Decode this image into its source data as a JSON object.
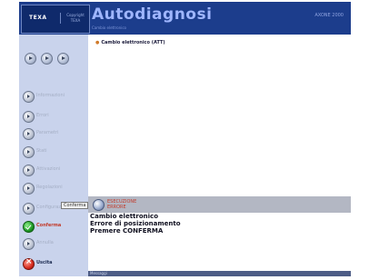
{
  "header": {
    "logo": "TEXA",
    "logo_sub": "Copyright TEXA",
    "title": "Autodiagnosi",
    "right_text": "AXONE 2000",
    "subtitle": "Cambio elettronico"
  },
  "sidebar": {
    "items": [
      {
        "label": "Informazioni"
      },
      {
        "label": "Errori"
      },
      {
        "label": "Parametri"
      },
      {
        "label": "Stati"
      },
      {
        "label": "Attivazioni"
      },
      {
        "label": "Regolazioni"
      },
      {
        "label": "Configurazioni"
      },
      {
        "label": "Conferma"
      },
      {
        "label": "Annulla"
      },
      {
        "label": "Uscita"
      }
    ],
    "tooltip": "Conferma"
  },
  "main": {
    "tree_item": "Cambio elettronico (ATT)"
  },
  "status": {
    "text_line1": "ESECUZIONE",
    "text_line2": "ERRORE"
  },
  "message": {
    "line1": "Cambio elettronico",
    "line2": "Errore di posizionamento",
    "line3": "Premere CONFERMA"
  },
  "footer": {
    "text": "Messaggi"
  }
}
